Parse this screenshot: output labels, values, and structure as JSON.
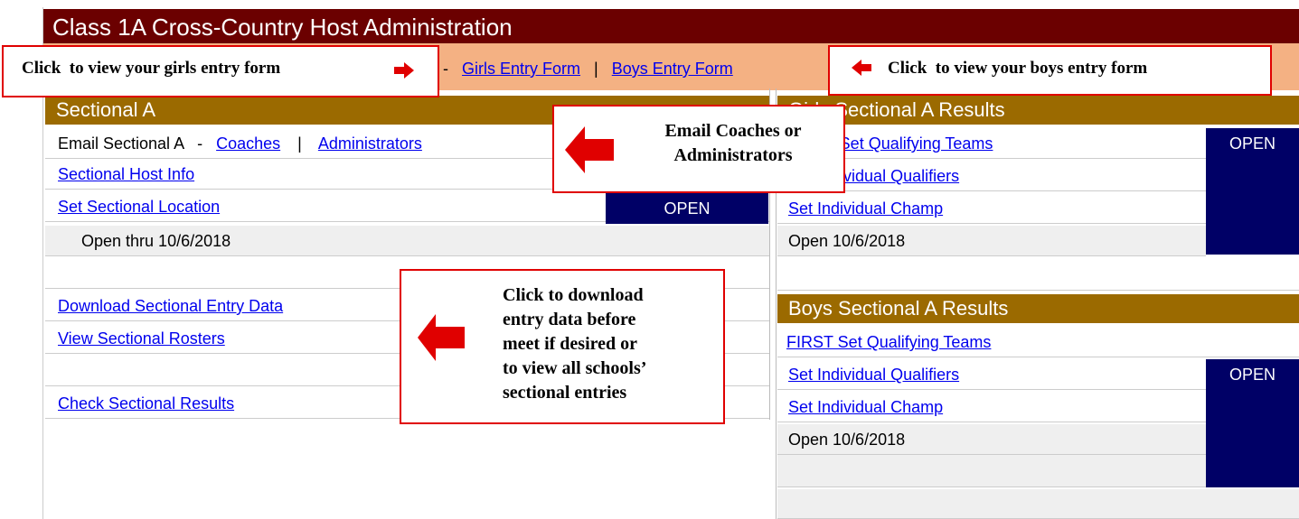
{
  "title": "Class 1A Cross-Country Host Administration",
  "entry_forms": {
    "dash": "-",
    "girls_link": "Girls Entry Form",
    "separator": "|",
    "boys_link": "Boys Entry Form"
  },
  "sectional": {
    "header": "Sectional A",
    "email_label": "Email Sectional A",
    "email_dash": "-",
    "coaches_link": "Coaches",
    "email_separator": "|",
    "administrators_link": "Administrators",
    "host_info_link": "Sectional Host Info",
    "set_location_link": "Set Sectional Location",
    "status": "OPEN",
    "open_thru": "Open thru 10/6/2018",
    "download_link": "Download Sectional Entry Data",
    "rosters_link": "View Sectional Rosters",
    "check_results_link": "Check Sectional Results"
  },
  "girls_results": {
    "header": "Girls Sectional A Results",
    "qualifying_teams_link": "FIRST Set Qualifying Teams",
    "individual_qualifiers_link": "Set Individual Qualifiers",
    "individual_champ_link": "Set Individual Champ",
    "open_date": "Open 10/6/2018",
    "status": "OPEN"
  },
  "boys_results": {
    "header": "Boys Sectional A Results",
    "qualifying_teams_link": "FIRST Set Qualifying Teams",
    "individual_qualifiers_link": "Set Individual Qualifiers",
    "individual_champ_link": "Set Individual Champ",
    "open_date": "Open 10/6/2018",
    "status": "OPEN"
  },
  "callouts": {
    "girls_entry": "Click  to view your girls entry form",
    "boys_entry": "Click  to view your boys entry form",
    "email": [
      "Email Coaches or",
      "Administrators"
    ],
    "download": [
      "Click to download",
      "entry data before",
      "meet if desired or",
      "to view all schools’",
      "sectional entries"
    ]
  },
  "colors": {
    "title_bg": "#6b0000",
    "strip_bg": "#f4b183",
    "header_bg": "#9b6a00",
    "open_bg": "#000066",
    "callout_border": "#e00000"
  }
}
